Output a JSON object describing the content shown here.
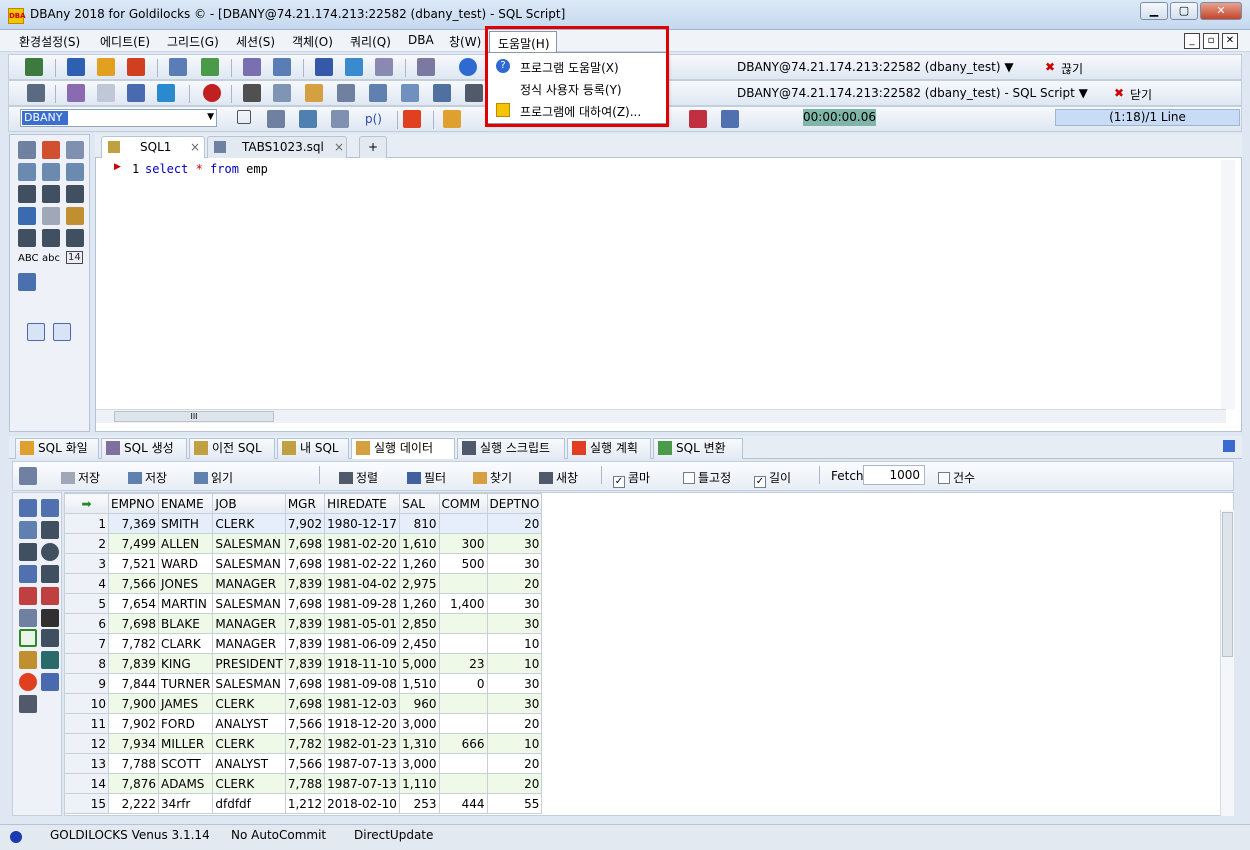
{
  "window": {
    "title": "DBAny 2018 for Goldilocks © - [DBANY@74.21.174.213:22582 (dbany_test) - SQL Script]",
    "icon": "DBA",
    "min": "▁",
    "max": "▢",
    "close": "✕"
  },
  "menu": {
    "items": [
      "환경설정(S)",
      "에디트(E)",
      "그리드(G)",
      "세션(S)",
      "객체(O)",
      "쿼리(Q)",
      "DBA",
      "창(W)",
      "도움말(H)"
    ],
    "mdi_min": "_",
    "mdi_restore": "▫",
    "mdi_close": "✕"
  },
  "help_menu": {
    "items": [
      "프로그램 도움말(X)",
      "정식 사용자 등록(Y)",
      "프로그램에 대하여(Z)..."
    ]
  },
  "conn": {
    "connection": "DBANY@74.21.174.213:22582 (dbany_test) ▼",
    "disconnect": "끊기",
    "script": "DBANY@74.21.174.213:22582 (dbany_test) - SQL Script ▼",
    "close": "닫기"
  },
  "toolbar": {
    "alias": "DBANY",
    "timer": "00:00:00.06",
    "linepos": "(1:18)/1 Line",
    "p_btn": "p()"
  },
  "editor": {
    "tabs": [
      "SQL1",
      "TABS1023.sql"
    ],
    "line_no": "1",
    "code_kw1": "select",
    "code_star": " * ",
    "code_kw2": "from",
    "code_rest": " emp",
    "tab_close": "×",
    "hscroll_grip": "III",
    "left_abc": "ABC",
    "left_abc2": "abc",
    "left_14": "14"
  },
  "bottom_tabs": [
    "SQL 화일",
    "SQL 생성",
    "이전 SQL",
    "내 SQL",
    "실행 데이터",
    "실행 스크립트",
    "실행 계획",
    "SQL 변환"
  ],
  "result_toolbar": {
    "save1": "저장",
    "save2": "저장",
    "read": "읽기",
    "sort": "정렬",
    "filter": "필터",
    "find": "찾기",
    "newwin": "새창",
    "comma": "콤마",
    "fixed": "틀고정",
    "length": "길이",
    "fetch_label": "Fetch",
    "fetch_value": "1000",
    "count": "건수"
  },
  "grid": {
    "columns": [
      "EMPNO",
      "ENAME",
      "JOB",
      "MGR",
      "HIREDATE",
      "SAL",
      "COMM",
      "DEPTNO"
    ],
    "rows": [
      [
        "1",
        "7,369",
        "SMITH",
        "CLERK",
        "7,902",
        "1980-12-17",
        "810",
        "",
        "20"
      ],
      [
        "2",
        "7,499",
        "ALLEN",
        "SALESMAN",
        "7,698",
        "1981-02-20",
        "1,610",
        "300",
        "30"
      ],
      [
        "3",
        "7,521",
        "WARD",
        "SALESMAN",
        "7,698",
        "1981-02-22",
        "1,260",
        "500",
        "30"
      ],
      [
        "4",
        "7,566",
        "JONES",
        "MANAGER",
        "7,839",
        "1981-04-02",
        "2,975",
        "",
        "20"
      ],
      [
        "5",
        "7,654",
        "MARTIN",
        "SALESMAN",
        "7,698",
        "1981-09-28",
        "1,260",
        "1,400",
        "30"
      ],
      [
        "6",
        "7,698",
        "BLAKE",
        "MANAGER",
        "7,839",
        "1981-05-01",
        "2,850",
        "",
        "30"
      ],
      [
        "7",
        "7,782",
        "CLARK",
        "MANAGER",
        "7,839",
        "1981-06-09",
        "2,450",
        "",
        "10"
      ],
      [
        "8",
        "7,839",
        "KING",
        "PRESIDENT",
        "7,839",
        "1918-11-10",
        "5,000",
        "23",
        "10"
      ],
      [
        "9",
        "7,844",
        "TURNER",
        "SALESMAN",
        "7,698",
        "1981-09-08",
        "1,510",
        "0",
        "30"
      ],
      [
        "10",
        "7,900",
        "JAMES",
        "CLERK",
        "7,698",
        "1981-12-03",
        "960",
        "",
        "30"
      ],
      [
        "11",
        "7,902",
        "FORD",
        "ANALYST",
        "7,566",
        "1918-12-20",
        "3,000",
        "",
        "20"
      ],
      [
        "12",
        "7,934",
        "MILLER",
        "CLERK",
        "7,782",
        "1982-01-23",
        "1,310",
        "666",
        "10"
      ],
      [
        "13",
        "7,788",
        "SCOTT",
        "ANALYST",
        "7,566",
        "1987-07-13",
        "3,000",
        "",
        "20"
      ],
      [
        "14",
        "7,876",
        "ADAMS",
        "CLERK",
        "7,788",
        "1987-07-13",
        "1,110",
        "",
        "20"
      ],
      [
        "15",
        "2,222",
        "34rfr",
        "dfdfdf",
        "1,212",
        "2018-02-10",
        "253",
        "444",
        "55"
      ]
    ]
  },
  "status": {
    "server": "GOLDILOCKS Venus 3.1.14",
    "autocommit": "No AutoCommit",
    "update": "DirectUpdate"
  }
}
